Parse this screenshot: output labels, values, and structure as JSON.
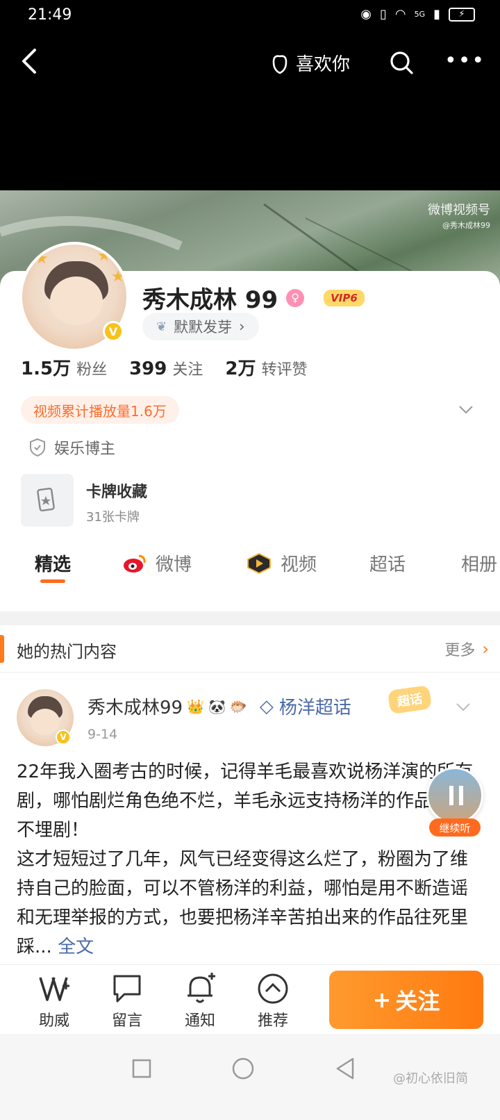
{
  "status_bar": {
    "time": "21:49",
    "network": "5G"
  },
  "top_bar": {
    "like_label": "喜欢你"
  },
  "cover": {
    "watermark": "微博视频号",
    "watermark_sub": "@秀木成林99"
  },
  "profile": {
    "name": "秀木成林 99",
    "vip_label": "VIP6",
    "level_label": "默默发芽",
    "stats": [
      {
        "value": "1.5万",
        "label": "粉丝"
      },
      {
        "value": "399",
        "label": "关注"
      },
      {
        "value": "2万",
        "label": "转评赞"
      }
    ],
    "play_badge": "视频累计播放量1.6万",
    "certification": "娱乐博主",
    "cards": {
      "title": "卡牌收藏",
      "subtitle": "31张卡牌"
    }
  },
  "tabs": [
    {
      "label": "精选",
      "active": true
    },
    {
      "label": "微博",
      "active": false
    },
    {
      "label": "视频",
      "active": false
    },
    {
      "label": "超话",
      "active": false
    },
    {
      "label": "相册",
      "active": false
    }
  ],
  "hot_section": {
    "title": "她的热门内容",
    "more_label": "更多"
  },
  "post": {
    "author": "秀木成林99",
    "topic": "杨洋超话",
    "chaohua_tag": "超话",
    "date": "9-14",
    "text": "22年我入圈考古的时候，记得羊毛最喜欢说杨洋演的所有剧，哪怕剧烂角色绝不烂，羊毛永远支持杨洋的作品，绝不埋剧！\n这才短短过了几年，风气已经变得这么烂了，粉圈为了维持自己的脸面，可以不管杨洋的利益，哪怕是用不断造谣和无理举报的方式，也要把杨洋辛苦拍出来的作品往死里踩...",
    "full_text_label": "全文"
  },
  "listen_widget": {
    "label": "继续听"
  },
  "bottom_actions": [
    {
      "label": "助威"
    },
    {
      "label": "留言"
    },
    {
      "label": "通知"
    },
    {
      "label": "推荐"
    }
  ],
  "follow_button": {
    "label": "关注"
  },
  "credit": "@初心依旧简",
  "colors": {
    "accent": "#ff7a10",
    "link": "#4a6aa8",
    "vip_gold": "#f7c31b"
  }
}
